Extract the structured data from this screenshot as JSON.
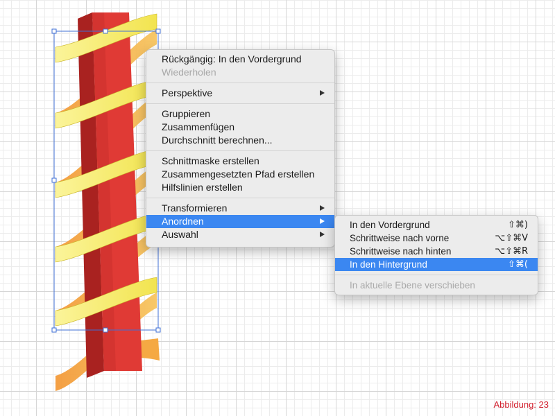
{
  "context_menu": {
    "groups": [
      [
        {
          "label": "Rückgängig: In den Vordergrund",
          "disabled": false
        },
        {
          "label": "Wiederholen",
          "disabled": true
        }
      ],
      [
        {
          "label": "Perspektive",
          "submenu": true
        }
      ],
      [
        {
          "label": "Gruppieren"
        },
        {
          "label": "Zusammenfügen"
        },
        {
          "label": "Durchschnitt berechnen..."
        }
      ],
      [
        {
          "label": "Schnittmaske erstellen"
        },
        {
          "label": "Zusammengesetzten Pfad erstellen"
        },
        {
          "label": "Hilfslinien erstellen"
        }
      ],
      [
        {
          "label": "Transformieren",
          "submenu": true
        },
        {
          "label": "Anordnen",
          "submenu": true,
          "active": true
        },
        {
          "label": "Auswahl",
          "submenu": true
        }
      ]
    ]
  },
  "submenu": {
    "items": [
      {
        "label": "In den Vordergrund",
        "shortcut": "⇧⌘)"
      },
      {
        "label": "Schrittweise nach vorne",
        "shortcut": "⌥⇧⌘V"
      },
      {
        "label": "Schrittweise nach hinten",
        "shortcut": "⌥⇧⌘R"
      },
      {
        "label": "In den Hintergrund",
        "shortcut": "⇧⌘(",
        "active": true
      }
    ],
    "footer_item": {
      "label": "In aktuelle Ebene verschieben",
      "disabled": true
    }
  },
  "caption": "Abbildung: 23",
  "colors": {
    "accent": "#3b87f1",
    "pillar_front": "#e23b36",
    "pillar_side": "#b0231f",
    "pillar_top": "#c52b26",
    "ribbon_front": "#f7ef72",
    "ribbon_back": "#f5b04a",
    "selection": "#3f6fd6",
    "caption": "#d21e2c"
  }
}
